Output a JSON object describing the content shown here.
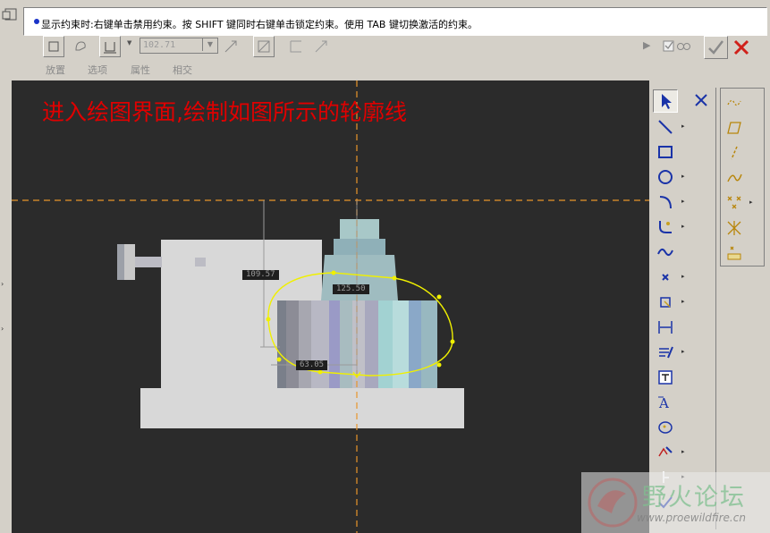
{
  "message": {
    "text": "显示约束时:右键单击禁用约束。按 SHIFT 键同时右键单击锁定约束。使用 TAB 键切换激活的约束。"
  },
  "dashboard": {
    "depth_value": "102.71",
    "tabs": [
      "放置",
      "选项",
      "属性",
      "相交"
    ]
  },
  "canvas": {
    "annotation": "进入绘图界面,绘制如图所示的轮廓线",
    "dimensions": [
      "109.57",
      "125.50",
      "63.05"
    ]
  },
  "sketch_tools": [
    "select-arrow-icon",
    "line-icon",
    "rectangle-icon",
    "circle-icon",
    "arc-icon",
    "fillet-icon",
    "spline-icon",
    "point-icon",
    "offset-edge-icon",
    "dimension-icon",
    "modify-icon",
    "constraint-icon",
    "text-icon",
    "palette-icon",
    "trim-icon",
    "mirror-icon",
    "done-check-icon"
  ],
  "colors": {
    "canvas_bg": "#2b2b2b",
    "annotation": "#e00000",
    "centerline": "#e8952b",
    "sketch": "#f0f000",
    "confirm": "#3a8a3a",
    "cancel": "#d0201a"
  },
  "watermark": {
    "title": "野火论坛",
    "url": "www.proewildfire.cn"
  }
}
